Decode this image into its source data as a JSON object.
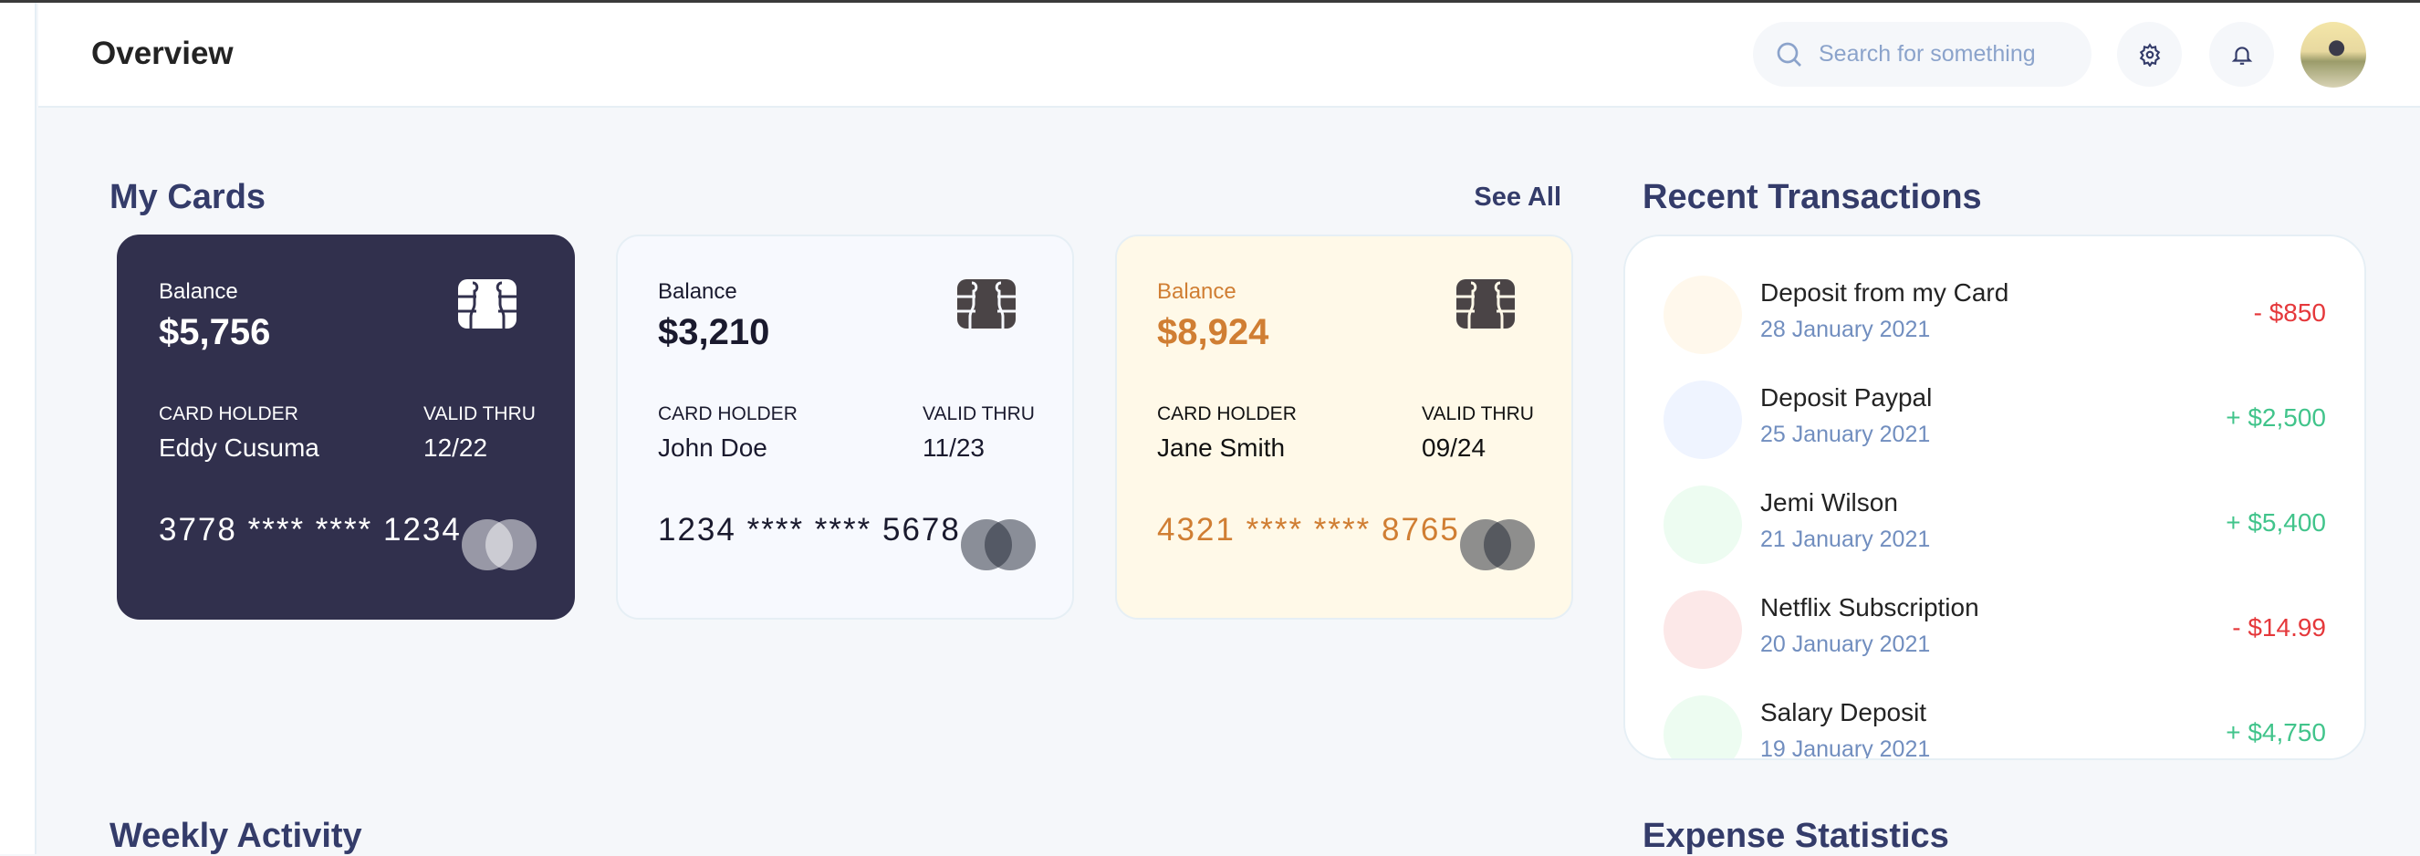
{
  "header": {
    "title": "Overview",
    "search_placeholder": "Search for something",
    "icons": [
      "search-icon",
      "gear-icon",
      "bell-icon",
      "avatar"
    ]
  },
  "my_cards": {
    "title": "My Cards",
    "see_all": "See All",
    "cards": [
      {
        "balance_label": "Balance",
        "balance": "$5,756",
        "holder_label": "CARD HOLDER",
        "holder": "Eddy Cusuma",
        "valid_label": "VALID THRU",
        "valid": "12/22",
        "number": "3778 **** **** 1234",
        "bg": "#31304D",
        "text": "#FFFFFF",
        "accent": "#FFFFFF",
        "chip": "#FFFFFF"
      },
      {
        "balance_label": "Balance",
        "balance": "$3,210",
        "holder_label": "CARD HOLDER",
        "holder": "John Doe",
        "valid_label": "VALID THRU",
        "valid": "11/23",
        "number": "1234 **** **** 5678",
        "bg": "#F7F9FE",
        "text": "#1A1A2E",
        "accent": "#1A1A2E",
        "chip": "#4A4446"
      },
      {
        "balance_label": "Balance",
        "balance": "$8,924",
        "holder_label": "CARD HOLDER",
        "holder": "Jane Smith",
        "valid_label": "VALID THRU",
        "valid": "09/24",
        "number": "4321 **** **** 8765",
        "bg": "#FFF9E8",
        "text": "#111111",
        "accent": "#D07E33",
        "chip": "#4A4446"
      }
    ]
  },
  "recent_transactions": {
    "title": "Recent Transactions",
    "items": [
      {
        "name": "Deposit from my Card",
        "date": "28 January 2021",
        "amount": "- $850",
        "type": "debit",
        "icon_bg": "#FFF8EC"
      },
      {
        "name": "Deposit Paypal",
        "date": "25 January 2021",
        "amount": "+ $2,500",
        "type": "credit",
        "icon_bg": "#EFF4FF"
      },
      {
        "name": "Jemi Wilson",
        "date": "21 January 2021",
        "amount": "+ $5,400",
        "type": "credit",
        "icon_bg": "#EDFCF1"
      },
      {
        "name": "Netflix Subscription",
        "date": "20 January 2021",
        "amount": "- $14.99",
        "type": "debit",
        "icon_bg": "#FCE8E8"
      },
      {
        "name": "Salary Deposit",
        "date": "19 January 2021",
        "amount": "+ $4,750",
        "type": "credit",
        "icon_bg": "#EDFCF1"
      }
    ]
  },
  "colors": {
    "debit": "#E5383B",
    "credit": "#41C48B",
    "heading": "#343C6A"
  },
  "sections": {
    "weekly_activity": "Weekly Activity",
    "expense_statistics": "Expense Statistics"
  }
}
